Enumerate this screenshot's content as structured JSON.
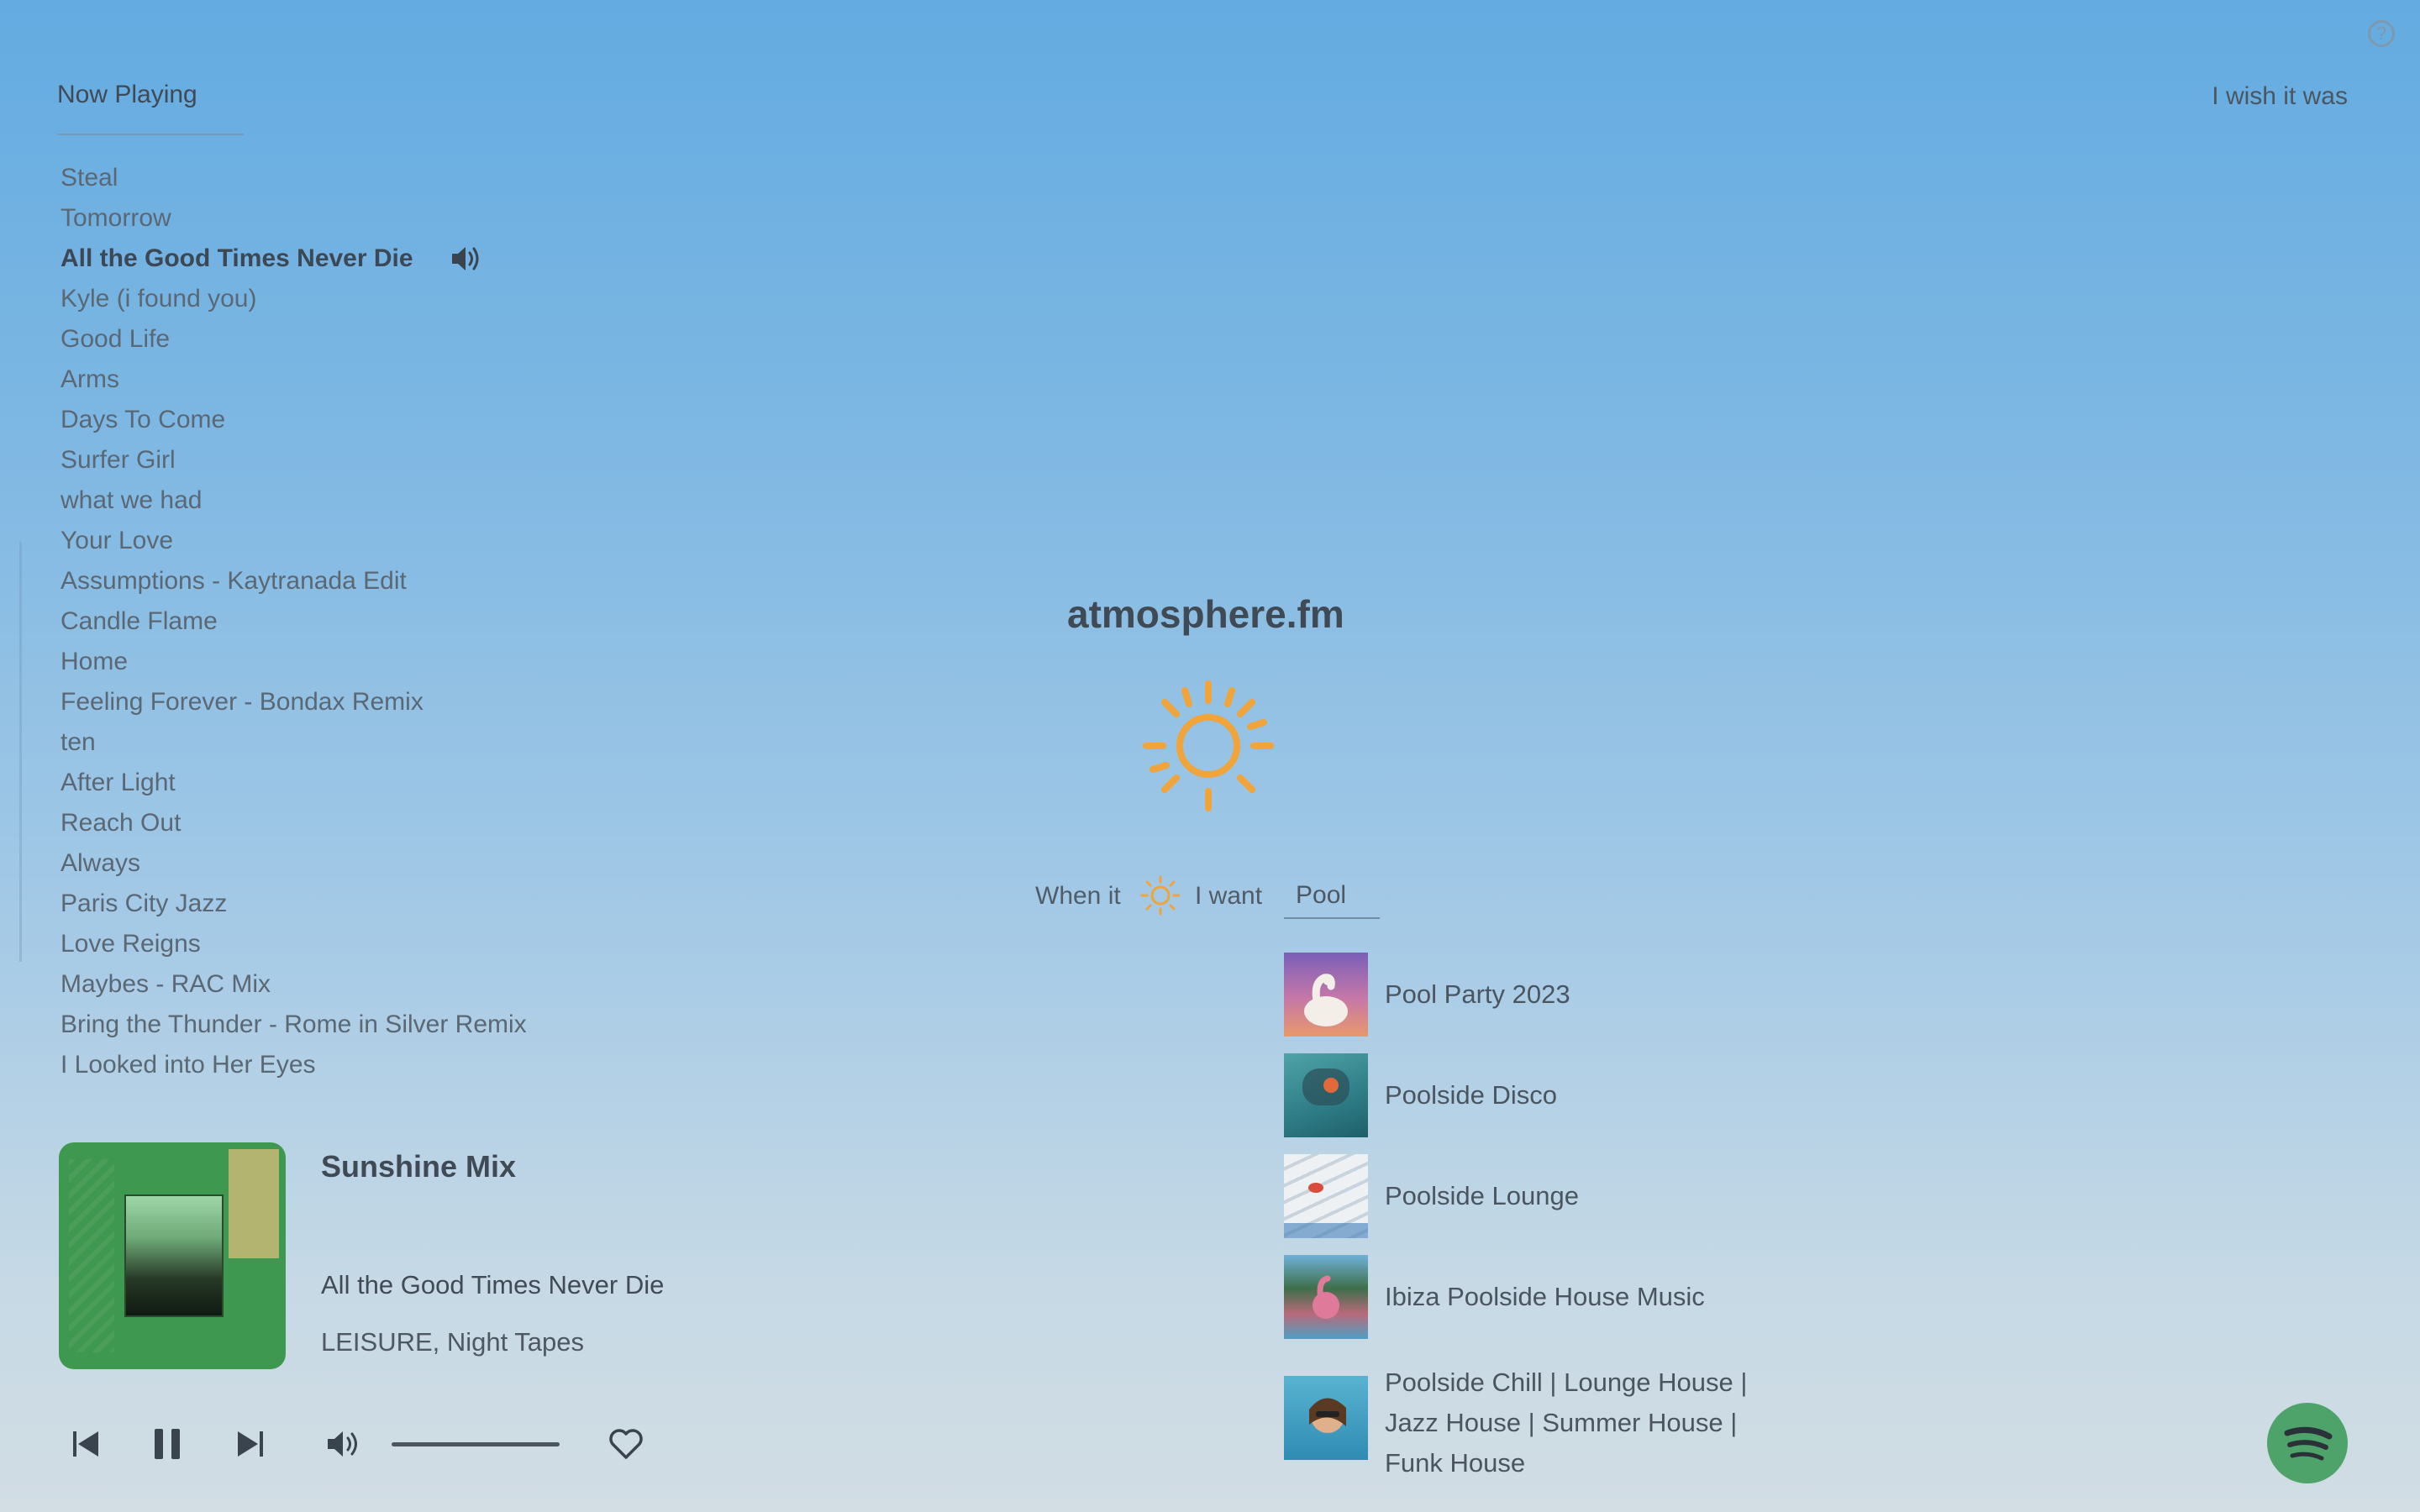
{
  "header": {
    "tab_now_playing": "Now Playing",
    "wish_label": "I wish it was",
    "help_icon": "question-circle-icon"
  },
  "tracks": [
    {
      "title": "Steal",
      "active": false
    },
    {
      "title": "Tomorrow",
      "active": false
    },
    {
      "title": "All the Good Times Never Die",
      "active": true
    },
    {
      "title": "Kyle (i found you)",
      "active": false
    },
    {
      "title": "Good Life",
      "active": false
    },
    {
      "title": "Arms",
      "active": false
    },
    {
      "title": "Days To Come",
      "active": false
    },
    {
      "title": "Surfer Girl",
      "active": false
    },
    {
      "title": "what we had",
      "active": false
    },
    {
      "title": "Your Love",
      "active": false
    },
    {
      "title": "Assumptions - Kaytranada Edit",
      "active": false
    },
    {
      "title": "Candle Flame",
      "active": false
    },
    {
      "title": "Home",
      "active": false
    },
    {
      "title": "Feeling Forever - Bondax Remix",
      "active": false
    },
    {
      "title": "ten",
      "active": false
    },
    {
      "title": "After Light",
      "active": false
    },
    {
      "title": "Reach Out",
      "active": false
    },
    {
      "title": "Always",
      "active": false
    },
    {
      "title": "Paris City Jazz",
      "active": false
    },
    {
      "title": "Love Reigns",
      "active": false
    },
    {
      "title": "Maybes - RAC Mix",
      "active": false
    },
    {
      "title": "Bring the Thunder - Rome in Silver Remix",
      "active": false
    },
    {
      "title": "I Looked into Her Eyes",
      "active": false
    }
  ],
  "player": {
    "playlist_name": "Sunshine Mix",
    "song_title": "All the Good Times Never Die",
    "artists": "LEISURE, Night Tapes",
    "volume_level": 1.0
  },
  "center": {
    "app_title": "atmosphere.fm",
    "weather_icon": "sun-icon",
    "when_label": "When it",
    "want_label": "I want",
    "search_value": "Pool"
  },
  "results": [
    {
      "label": "Pool Party 2023"
    },
    {
      "label": "Poolside Disco"
    },
    {
      "label": "Poolside Lounge"
    },
    {
      "label": "Ibiza Poolside House Music"
    },
    {
      "label": "Poolside Chill | Lounge House | Jazz House | Summer House | Funk House"
    }
  ],
  "colors": {
    "sun": "#f0a43a",
    "spotify": "#4ea36a",
    "album_green": "#3f9850"
  }
}
